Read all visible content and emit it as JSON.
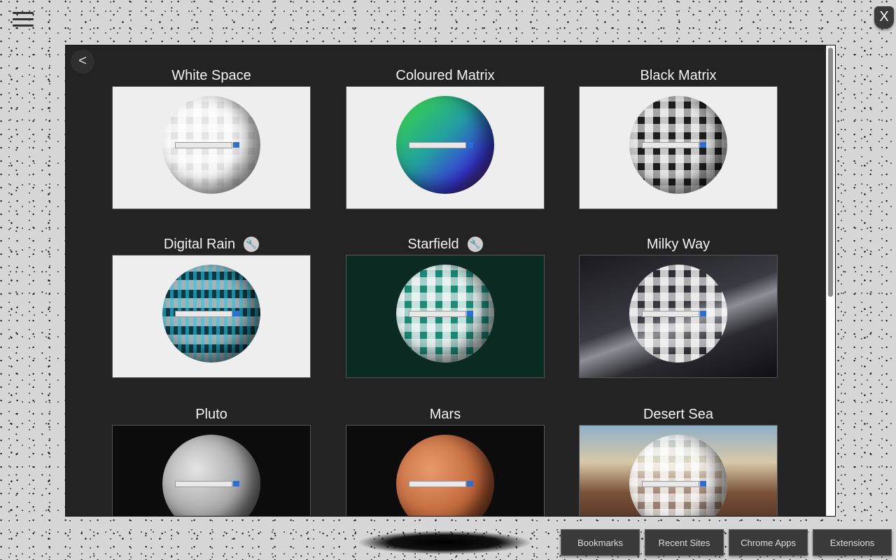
{
  "close_label": "X",
  "back_label": "<",
  "themes": [
    {
      "name": "White Space",
      "config": false
    },
    {
      "name": "Coloured Matrix",
      "config": false
    },
    {
      "name": "Black Matrix",
      "config": false
    },
    {
      "name": "Digital Rain",
      "config": true
    },
    {
      "name": "Starfield",
      "config": true
    },
    {
      "name": "Milky Way",
      "config": false
    },
    {
      "name": "Pluto",
      "config": false
    },
    {
      "name": "Mars",
      "config": false
    },
    {
      "name": "Desert Sea",
      "config": false
    }
  ],
  "bottom_buttons": [
    "Bookmarks",
    "Recent Sites",
    "Chrome Apps",
    "Extensions"
  ],
  "colors": {
    "panel_bg": "#232323",
    "search_button": "#2a6ed8",
    "page_bg": "#d6d6d6"
  }
}
